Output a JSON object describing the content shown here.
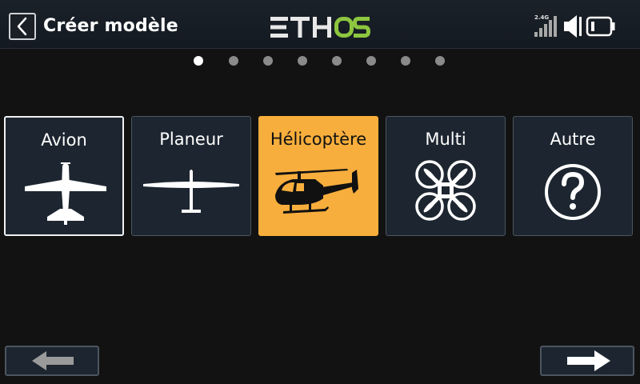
{
  "header": {
    "title": "Créer modèle",
    "logo_text": "ETHOS",
    "band_label": "2.4G"
  },
  "pager": {
    "count": 8,
    "active_index": 0
  },
  "tiles": [
    {
      "label": "Avion",
      "icon": "airplane-icon",
      "state": "focused"
    },
    {
      "label": "Planeur",
      "icon": "glider-icon",
      "state": "normal"
    },
    {
      "label": "Hélicoptère",
      "icon": "helicopter-icon",
      "state": "selected"
    },
    {
      "label": "Multi",
      "icon": "quadcopter-icon",
      "state": "normal"
    },
    {
      "label": "Autre",
      "icon": "question-icon",
      "state": "normal"
    }
  ],
  "nav": {
    "prev_icon": "arrow-left-icon",
    "next_icon": "arrow-right-icon"
  },
  "colors": {
    "accent": "#f7ae3c",
    "logo_green": "#8dc63f",
    "tile_bg": "#1d2630",
    "background": "#121212"
  }
}
